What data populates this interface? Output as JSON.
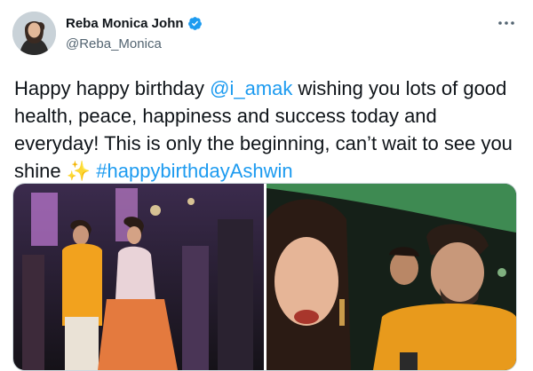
{
  "author": {
    "display_name": "Reba Monica John",
    "handle": "@Reba_Monica",
    "verified": true,
    "avatar_icon": "user-avatar"
  },
  "header": {
    "more_icon": "more-dots-icon"
  },
  "tweet": {
    "text_part1": "Happy happy birthday ",
    "mention": "@i_amak",
    "text_part2": " wishing you lots of good health, peace, happiness and success today and everyday! This is only the beginning, can’t wait to see you shine ",
    "emoji": "✨",
    "text_space": " ",
    "hashtag": "#happybirthdayAshwin"
  },
  "media": {
    "photos": [
      {
        "name": "party-dance-photo"
      },
      {
        "name": "selfie-photo"
      }
    ]
  },
  "colors": {
    "accent": "#1d9bf0",
    "text": "#0f1419",
    "muted": "#536471"
  }
}
